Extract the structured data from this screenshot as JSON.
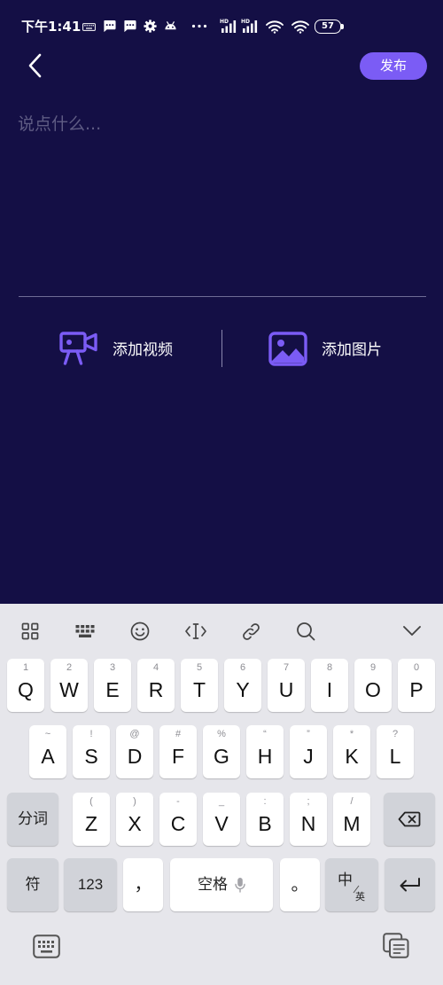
{
  "colors": {
    "background": "#140f45",
    "accent": "#7b5cf5",
    "keyboard_background": "#e6e6eb",
    "key_background": "#ffffff",
    "function_key_background": "#d1d3d9"
  },
  "status_bar": {
    "time": "下午1:41",
    "network_label": "HD",
    "battery": "57",
    "icons": [
      "keyboard-icon",
      "message-icon",
      "message-icon",
      "gear-icon",
      "android-icon",
      "more-dots-icon",
      "signal-icon",
      "signal-icon",
      "wifi-icon",
      "wifi-icon",
      "battery-icon"
    ]
  },
  "header": {
    "back_icon": "chevron-left-icon",
    "publish_label": "发布"
  },
  "composer": {
    "placeholder": "说点什么..."
  },
  "media": {
    "add_video_icon": "video-camera-icon",
    "add_video_label": "添加视频",
    "add_image_icon": "image-icon",
    "add_image_label": "添加图片"
  },
  "keyboard": {
    "toolbar_icons": [
      "grid-icon",
      "keyboard-icon",
      "emoji-icon",
      "text-cursor-icon",
      "link-icon",
      "search-icon",
      "chevron-down-icon"
    ],
    "row1": [
      {
        "letter": "Q",
        "hint": "1"
      },
      {
        "letter": "W",
        "hint": "2"
      },
      {
        "letter": "E",
        "hint": "3"
      },
      {
        "letter": "R",
        "hint": "4"
      },
      {
        "letter": "T",
        "hint": "5"
      },
      {
        "letter": "Y",
        "hint": "6"
      },
      {
        "letter": "U",
        "hint": "7"
      },
      {
        "letter": "I",
        "hint": "8"
      },
      {
        "letter": "O",
        "hint": "9"
      },
      {
        "letter": "P",
        "hint": "0"
      }
    ],
    "row2": [
      {
        "letter": "A",
        "hint": "~"
      },
      {
        "letter": "S",
        "hint": "!"
      },
      {
        "letter": "D",
        "hint": "@"
      },
      {
        "letter": "F",
        "hint": "#"
      },
      {
        "letter": "G",
        "hint": "%"
      },
      {
        "letter": "H",
        "hint": "“"
      },
      {
        "letter": "J",
        "hint": "”"
      },
      {
        "letter": "K",
        "hint": "*"
      },
      {
        "letter": "L",
        "hint": "?"
      }
    ],
    "row3": [
      {
        "letter": "Z",
        "hint": "("
      },
      {
        "letter": "X",
        "hint": ")"
      },
      {
        "letter": "C",
        "hint": "-"
      },
      {
        "letter": "V",
        "hint": "_"
      },
      {
        "letter": "B",
        "hint": ":"
      },
      {
        "letter": "N",
        "hint": ";"
      },
      {
        "letter": "M",
        "hint": "/"
      }
    ],
    "segment_label": "分词",
    "backspace_icon": "backspace-icon",
    "symbols_label": "符",
    "numbers_label": "123",
    "comma": "，",
    "space_label": "空格",
    "space_icon": "microphone-icon",
    "period": "。",
    "lang_primary": "中",
    "lang_secondary": "英",
    "enter_icon": "enter-icon",
    "bottom_icons": [
      "keyboard-switch-icon",
      "clipboard-icon"
    ]
  }
}
